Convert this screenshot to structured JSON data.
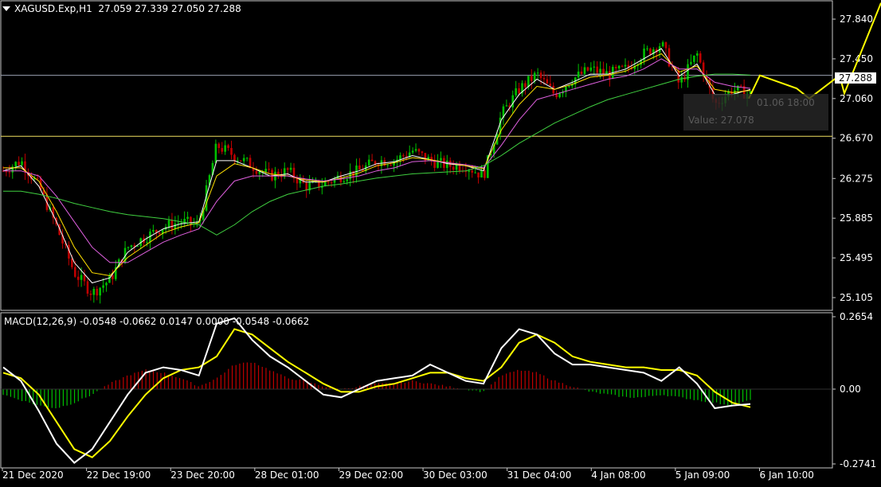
{
  "header": {
    "symbol": "XAGUSD.Exp,H1",
    "ohlc": "27.059 27.339 27.050 27.288"
  },
  "macd_header": "MACD(12,26,9) -0.0548 -0.0662 0.0147 0.0000 -0.0548 -0.0662",
  "current_price": "27.288",
  "tooltip": {
    "line1": "01.06 18:00",
    "line2": "Value: 27.078"
  },
  "colors": {
    "background": "#000000",
    "bull": "#00c000",
    "bear": "#c00000",
    "ma_fast": "#ffffff",
    "ma_mid": "#ffe000",
    "ma_slow_pink": "#e060e0",
    "ma_long": "#40d040",
    "macd_line": "#ffffff",
    "signal_line": "#ffff00",
    "forecast": "#ffff00",
    "level_line": "#f0e060",
    "grid_border": "#c8c8c8"
  },
  "chart_data": [
    {
      "type": "candlestick",
      "title": "XAGUSD.Exp,H1",
      "yticks": [
        "27.840",
        "27.450",
        "27.060",
        "26.670",
        "26.275",
        "25.885",
        "25.495",
        "25.105"
      ],
      "ylim": [
        24.98,
        28.02
      ],
      "xticks": [
        "21 Dec 2020",
        "22 Dec 19:00",
        "23 Dec 20:00",
        "28 Dec 01:00",
        "29 Dec 02:00",
        "30 Dec 03:00",
        "31 Dec 04:00",
        "4 Jan 08:00",
        "5 Jan 09:00",
        "6 Jan 10:00"
      ],
      "close_path": [
        26.35,
        26.45,
        26.2,
        25.8,
        25.35,
        25.15,
        25.28,
        25.6,
        25.7,
        25.8,
        25.85,
        25.82,
        26.6,
        26.5,
        26.4,
        26.3,
        26.35,
        26.2,
        26.22,
        26.3,
        26.35,
        26.45,
        26.45,
        26.55,
        26.45,
        26.4,
        26.4,
        26.3,
        26.9,
        27.15,
        27.3,
        27.1,
        27.25,
        27.35,
        27.3,
        27.35,
        27.5,
        27.6,
        27.2,
        27.5,
        27.0,
        27.15,
        27.1
      ],
      "horizontal_levels": [
        27.288,
        26.69
      ],
      "moving_averages": [
        {
          "color": "ma_fast",
          "points": [
            26.35,
            26.4,
            26.2,
            25.85,
            25.45,
            25.25,
            25.3,
            25.55,
            25.68,
            25.78,
            25.83,
            25.85,
            26.45,
            26.45,
            26.38,
            26.3,
            26.32,
            26.24,
            26.24,
            26.3,
            26.35,
            26.42,
            26.44,
            26.5,
            26.46,
            26.42,
            26.4,
            26.35,
            26.85,
            27.1,
            27.25,
            27.15,
            27.22,
            27.3,
            27.3,
            27.35,
            27.45,
            27.55,
            27.28,
            27.4,
            27.1,
            27.1,
            27.15
          ]
        },
        {
          "color": "ma_mid",
          "points": [
            26.38,
            26.38,
            26.25,
            25.95,
            25.6,
            25.35,
            25.32,
            25.5,
            25.62,
            25.74,
            25.8,
            25.84,
            26.3,
            26.42,
            26.38,
            26.32,
            26.3,
            26.26,
            26.24,
            26.28,
            26.33,
            26.4,
            26.43,
            26.48,
            26.46,
            26.43,
            26.4,
            26.37,
            26.75,
            27.0,
            27.18,
            27.15,
            27.2,
            27.27,
            27.29,
            27.33,
            27.42,
            27.5,
            27.32,
            27.38,
            27.15,
            27.12,
            27.14
          ]
        },
        {
          "color": "ma_slow_pink",
          "points": [
            26.35,
            26.35,
            26.3,
            26.1,
            25.85,
            25.6,
            25.45,
            25.45,
            25.55,
            25.65,
            25.72,
            25.78,
            26.05,
            26.25,
            26.3,
            26.3,
            26.3,
            26.27,
            26.25,
            26.27,
            26.3,
            26.35,
            26.38,
            26.44,
            26.45,
            26.43,
            26.41,
            26.38,
            26.6,
            26.85,
            27.05,
            27.1,
            27.15,
            27.2,
            27.25,
            27.28,
            27.35,
            27.45,
            27.35,
            27.35,
            27.22,
            27.18,
            27.16
          ]
        },
        {
          "color": "ma_long",
          "points": [
            26.15,
            26.15,
            26.12,
            26.08,
            26.03,
            25.99,
            25.95,
            25.92,
            25.9,
            25.88,
            25.85,
            25.82,
            25.72,
            25.82,
            25.95,
            26.05,
            26.12,
            26.16,
            26.2,
            26.22,
            26.25,
            26.28,
            26.3,
            26.32,
            26.33,
            26.34,
            26.35,
            26.4,
            26.5,
            26.62,
            26.72,
            26.82,
            26.9,
            26.98,
            27.05,
            27.1,
            27.15,
            27.2,
            27.25,
            27.28,
            27.3,
            27.3,
            27.29
          ]
        }
      ],
      "forecast_path": [
        27.06,
        27.288,
        27.16,
        27.06,
        27.288,
        27.11,
        28.0
      ]
    },
    {
      "type": "bar",
      "title": "MACD(12,26,9)",
      "yticks": [
        "0.2654",
        "0.00",
        "-0.2741"
      ],
      "ylim": [
        -0.2741,
        0.2654
      ],
      "histogram": [
        -0.02,
        -0.04,
        -0.06,
        -0.07,
        -0.05,
        -0.02,
        0.02,
        0.05,
        0.07,
        0.06,
        0.04,
        0.01,
        0.04,
        0.09,
        0.1,
        0.07,
        0.04,
        0.03,
        0.01,
        0.0,
        0.01,
        0.02,
        0.02,
        0.03,
        0.02,
        0.01,
        0.0,
        -0.01,
        0.05,
        0.07,
        0.06,
        0.03,
        0.01,
        -0.01,
        -0.02,
        -0.03,
        -0.03,
        -0.02,
        -0.03,
        -0.04,
        -0.05,
        -0.06,
        -0.04
      ],
      "macd": [
        0.08,
        0.03,
        -0.08,
        -0.2,
        -0.27,
        -0.22,
        -0.12,
        -0.02,
        0.06,
        0.08,
        0.07,
        0.05,
        0.24,
        0.26,
        0.18,
        0.12,
        0.08,
        0.03,
        -0.02,
        -0.03,
        0.0,
        0.03,
        0.04,
        0.05,
        0.09,
        0.06,
        0.03,
        0.02,
        0.15,
        0.22,
        0.2,
        0.13,
        0.09,
        0.09,
        0.08,
        0.07,
        0.06,
        0.03,
        0.08,
        0.02,
        -0.07,
        -0.06,
        -0.0548
      ],
      "signal": [
        0.06,
        0.04,
        -0.02,
        -0.12,
        -0.22,
        -0.25,
        -0.19,
        -0.1,
        -0.02,
        0.04,
        0.07,
        0.08,
        0.12,
        0.22,
        0.2,
        0.15,
        0.1,
        0.06,
        0.02,
        -0.01,
        -0.01,
        0.01,
        0.02,
        0.04,
        0.06,
        0.06,
        0.04,
        0.03,
        0.08,
        0.17,
        0.2,
        0.17,
        0.12,
        0.1,
        0.09,
        0.08,
        0.08,
        0.07,
        0.07,
        0.05,
        -0.01,
        -0.05,
        -0.0662
      ]
    }
  ]
}
